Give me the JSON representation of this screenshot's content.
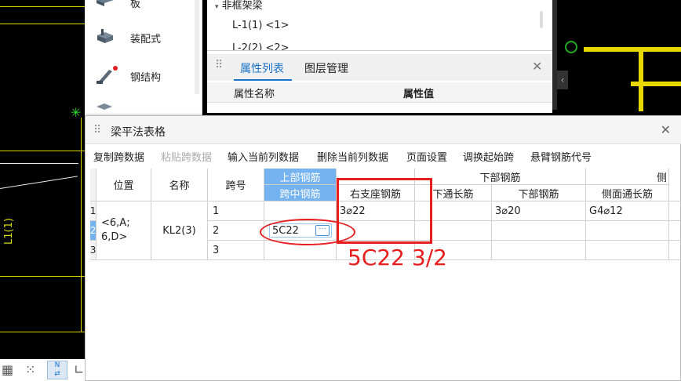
{
  "categories": [
    {
      "label": "板",
      "icon": "slab-icon"
    },
    {
      "label": "装配式",
      "icon": "prefab-icon"
    },
    {
      "label": "钢结构",
      "icon": "steel-structure-icon"
    }
  ],
  "tree": {
    "group": "非框架梁",
    "item1": "L-1(1) <1>",
    "item2": "L-2(2) <2>"
  },
  "properties": {
    "tabs": [
      "属性列表",
      "图层管理"
    ],
    "col_name": "属性名称",
    "col_value": "属性值"
  },
  "cad_label": "L1(1)",
  "dialog": {
    "title": "梁平法表格",
    "toolbar": [
      "复制跨数据",
      "粘贴跨数据",
      "输入当前列数据",
      "删除当前列数据",
      "页面设置",
      "调换起始跨",
      "悬臂钢筋代号"
    ],
    "headers": {
      "position": "位置",
      "name": "名称",
      "span": "跨号",
      "top_rebar": "上部钢筋",
      "mid_rebar": "跨中钢筋",
      "right_support": "右支座钢筋",
      "bottom_rebar": "下部钢筋",
      "bottom_through": "下通长筋",
      "bottom_main": "下部钢筋",
      "side_through": "侧面通长筋",
      "side_partial": "侧"
    },
    "row_numbers": [
      "1",
      "2",
      "3"
    ],
    "position_value": "<6,A;\n6,D>",
    "name_value": "KL2(3)",
    "spans": [
      "1",
      "2",
      "3"
    ],
    "editing_value": "5C22",
    "rows": [
      {
        "right_support": "3⌀22",
        "bottom_main": "3⌀20",
        "side_through": "G4⌀12"
      },
      {
        "right_support": "",
        "bottom_main": "",
        "side_through": ""
      },
      {
        "right_support": "",
        "bottom_main": "",
        "side_through": ""
      }
    ]
  },
  "annotation": "5C22 3/2",
  "colors": {
    "accent": "#1a73c9",
    "header_blue": "#74b3f0",
    "annotation_red": "#e81d1d",
    "cad_yellow": "#d8d800"
  }
}
